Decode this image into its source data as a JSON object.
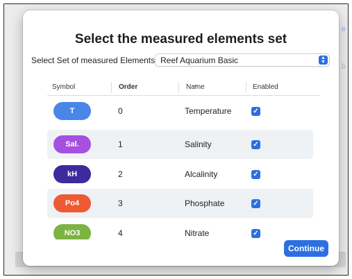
{
  "background": {
    "hint_link": "e",
    "hint_text": "b"
  },
  "dialog": {
    "title": "Select the measured elements set",
    "set_label": "Select Set of measured Elements",
    "set_value": "Reef Aquarium Basic",
    "columns": {
      "symbol": "Symbol",
      "order": "Order",
      "name": "Name",
      "enabled": "Enabled"
    },
    "sort_indicator": "^",
    "rows": [
      {
        "symbol": "T",
        "order": "0",
        "name": "Temperature",
        "enabled": true,
        "color": "#4a86e8"
      },
      {
        "symbol": "Sal.",
        "order": "1",
        "name": "Salinity",
        "enabled": true,
        "color": "#a64fe0"
      },
      {
        "symbol": "kH",
        "order": "2",
        "name": "Alcalinity",
        "enabled": true,
        "color": "#3d2a9c"
      },
      {
        "symbol": "Po4",
        "order": "3",
        "name": "Phosphate",
        "enabled": true,
        "color": "#ee5a34"
      },
      {
        "symbol": "NO3",
        "order": "4",
        "name": "Nitrate",
        "enabled": true,
        "color": "#7cb342"
      }
    ],
    "continue_label": "Continue",
    "accent_color": "#2c6fe0"
  }
}
